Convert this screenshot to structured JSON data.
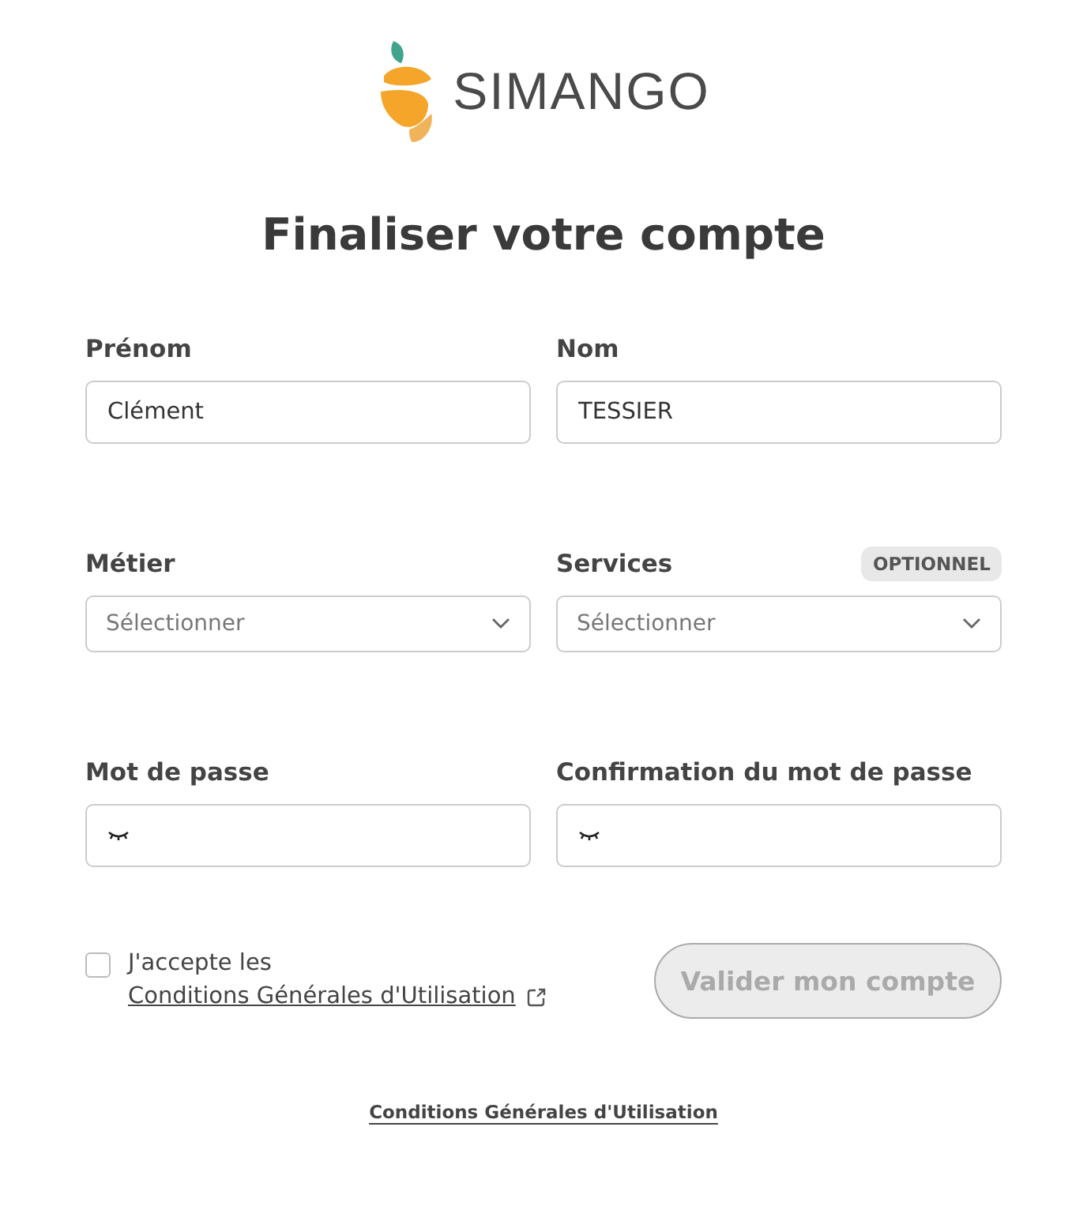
{
  "logo": {
    "text": "SIMANGO"
  },
  "title": "Finaliser votre compte",
  "rows": [
    {
      "fields": [
        {
          "kind": "text",
          "label": "Prénom",
          "value": "Clément"
        },
        {
          "kind": "text",
          "label": "Nom",
          "value": "TESSIER"
        }
      ]
    },
    {
      "fields": [
        {
          "kind": "select",
          "label": "Métier",
          "placeholder": "Sélectionner"
        },
        {
          "kind": "select",
          "label": "Services",
          "placeholder": "Sélectionner",
          "badge": "OPTIONNEL"
        }
      ]
    },
    {
      "fields": [
        {
          "kind": "password",
          "label": "Mot de passe"
        },
        {
          "kind": "password",
          "label": "Confirmation du mot de passe"
        }
      ]
    }
  ],
  "terms": {
    "checked": false,
    "text": "J'accepte les",
    "link": "Conditions Générales d'Utilisation"
  },
  "submit": {
    "label": "Valider mon compte",
    "disabled": true
  },
  "footer_link": "Conditions Générales d'Utilisation"
}
